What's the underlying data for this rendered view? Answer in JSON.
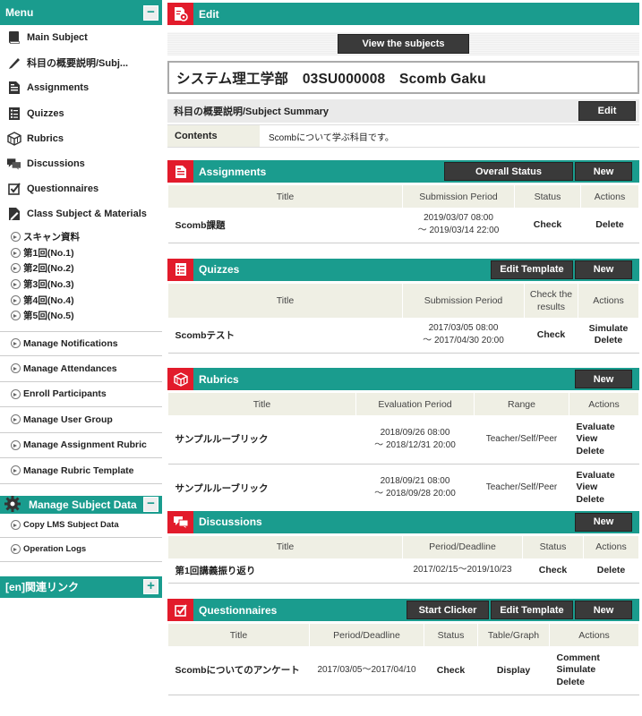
{
  "sidebar": {
    "title": "Menu",
    "collapse_symbol": "−",
    "nav": [
      {
        "label": "Main Subject",
        "icon": "book-icon"
      },
      {
        "label": "科目の概要説明/Subj...",
        "icon": "pencil-icon"
      },
      {
        "label": "Assignments",
        "icon": "document-icon"
      },
      {
        "label": "Quizzes",
        "icon": "checklist-icon"
      },
      {
        "label": "Rubrics",
        "icon": "rubric-cube-icon"
      },
      {
        "label": "Discussions",
        "icon": "chat-bubbles-icon"
      },
      {
        "label": "Questionnaires",
        "icon": "checkbox-icon"
      },
      {
        "label": "Class Subject & Materials",
        "icon": "materials-icon"
      }
    ],
    "materials": [
      "スキャン資料",
      "第1回(No.1)",
      "第2回(No.2)",
      "第3回(No.3)",
      "第4回(No.4)",
      "第5回(No.5)"
    ],
    "manage": [
      "Manage Notifications",
      "Manage Attendances",
      "Enroll Participants",
      "Manage User Group",
      "Manage Assignment Rubric",
      "Manage Rubric Template"
    ],
    "subject_data": {
      "title": "Manage Subject Data",
      "collapse_symbol": "−",
      "items": [
        "Copy LMS Subject Data",
        "Operation Logs"
      ]
    },
    "links": {
      "title": "[en]関連リンク",
      "expand_symbol": "+"
    }
  },
  "main": {
    "edit": {
      "title": "Edit",
      "view_button": "View the subjects"
    },
    "subject_line": "システム理工学部　03SU000008　Scomb Gaku",
    "summary": {
      "title": "科目の概要説明/Subject Summary",
      "edit_button": "Edit",
      "contents_label": "Contents",
      "contents_value": "Scombについて学ぶ科目です。"
    },
    "assignments": {
      "title": "Assignments",
      "buttons": [
        "Overall Status",
        "New"
      ],
      "columns": [
        "Title",
        "Submission Period",
        "Status",
        "Actions"
      ],
      "rows": [
        {
          "title": "Scomb課題",
          "period_start": "2019/03/07 08:00",
          "period_end": "～ 2019/03/14 22:00",
          "status": "Check",
          "actions": [
            "Delete"
          ]
        }
      ]
    },
    "quizzes": {
      "title": "Quizzes",
      "buttons": [
        "Edit Template",
        "New"
      ],
      "columns": [
        "Title",
        "Submission Period",
        "Check the results",
        "Actions"
      ],
      "rows": [
        {
          "title": "Scombテスト",
          "period_start": "2017/03/05 08:00",
          "period_end": "～ 2017/04/30 20:00",
          "status": "Check",
          "actions": [
            "Simulate",
            "Delete"
          ]
        }
      ]
    },
    "rubrics": {
      "title": "Rubrics",
      "buttons": [
        "New"
      ],
      "columns": [
        "Title",
        "Evaluation Period",
        "Range",
        "Actions"
      ],
      "rows": [
        {
          "title": "サンプルルーブリック",
          "period_start": "2018/09/26 08:00",
          "period_end": "～ 2018/12/31 20:00",
          "range": "Teacher/Self/Peer",
          "actions": [
            "Evaluate",
            "View",
            "Delete"
          ]
        },
        {
          "title": "サンプルルーブリック",
          "period_start": "2018/09/21 08:00",
          "period_end": "～ 2018/09/28 20:00",
          "range": "Teacher/Self/Peer",
          "actions": [
            "Evaluate",
            "View",
            "Delete"
          ]
        }
      ]
    },
    "discussions": {
      "title": "Discussions",
      "buttons": [
        "New"
      ],
      "columns": [
        "Title",
        "Period/Deadline",
        "Status",
        "Actions"
      ],
      "rows": [
        {
          "title": "第1回講義振り返り",
          "period": "2017/02/15～2019/10/23",
          "status": "Check",
          "actions": [
            "Delete"
          ]
        }
      ]
    },
    "questionnaires": {
      "title": "Questionnaires",
      "buttons": [
        "Start Clicker",
        "Edit Template",
        "New"
      ],
      "columns": [
        "Title",
        "Period/Deadline",
        "Status",
        "Table/Graph",
        "Actions"
      ],
      "rows": [
        {
          "title": "Scombについてのアンケート",
          "period": "2017/03/05～2017/04/10",
          "status": "Check",
          "table": "Display",
          "actions": [
            "Comment",
            "Simulate",
            "Delete"
          ]
        }
      ]
    }
  },
  "colors": {
    "teal": "#1a9c8e",
    "red": "#e21b2b",
    "dark_button": "#3a3a3a",
    "header_cell": "#efefe4"
  }
}
